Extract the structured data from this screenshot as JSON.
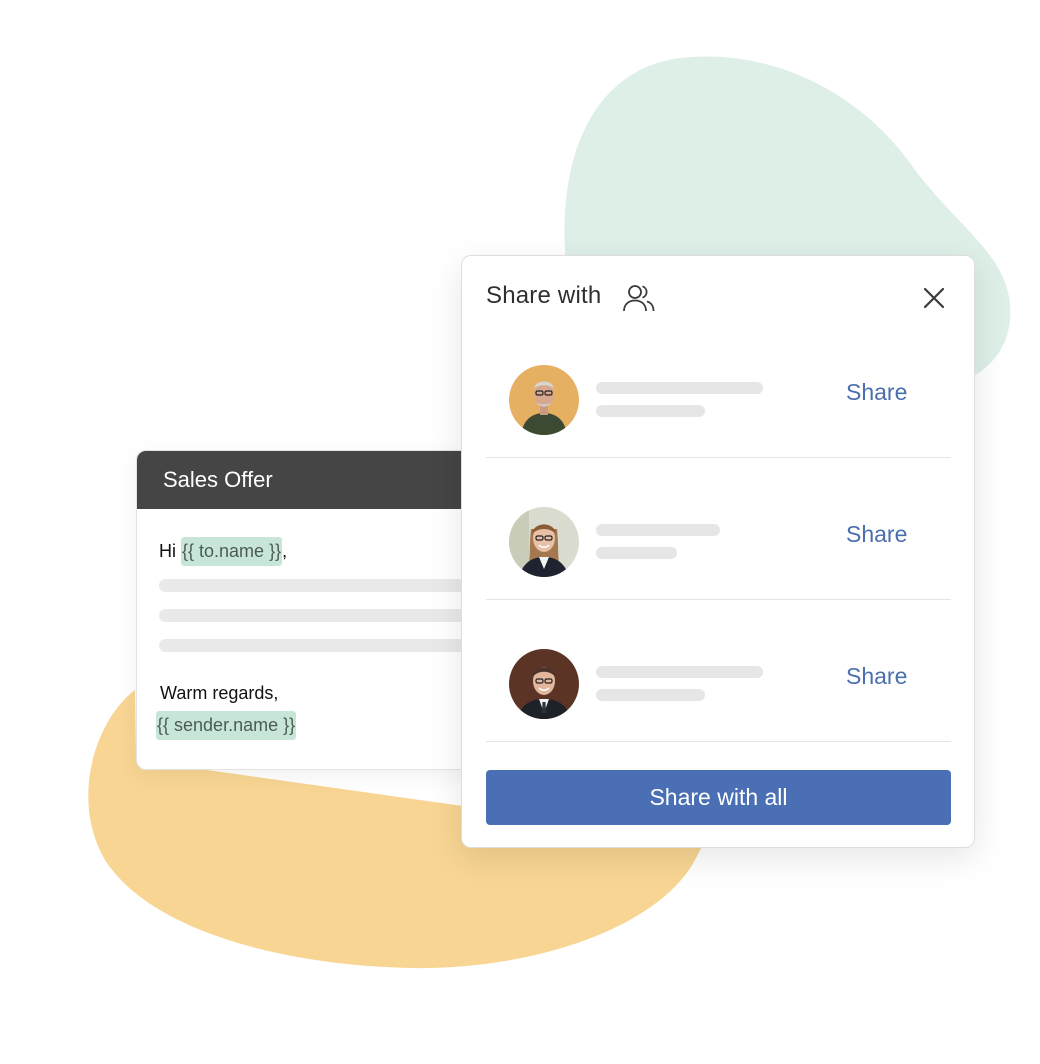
{
  "template": {
    "title": "Sales Offer",
    "greeting_prefix": "Hi",
    "to_token": "{{ to.name }}",
    "greeting_suffix": ",",
    "closing": "Warm regards,",
    "sender_token": "{{ sender.name }}"
  },
  "share_panel": {
    "title": "Share with",
    "people_icon": "people-icon",
    "close_icon": "close-icon",
    "contacts": [
      {
        "avatar": "avatar-man-glasses",
        "action_label": "Share"
      },
      {
        "avatar": "avatar-woman-glasses",
        "action_label": "Share"
      },
      {
        "avatar": "avatar-man-suit",
        "action_label": "Share"
      }
    ],
    "share_all_label": "Share with all"
  },
  "colors": {
    "accent": "#4a6fb5",
    "link": "#4a6fae",
    "token_bg": "#c8e6d8",
    "header_bg": "#454545",
    "blob_green": "#deefe8",
    "blob_yellow": "#f8d592"
  }
}
